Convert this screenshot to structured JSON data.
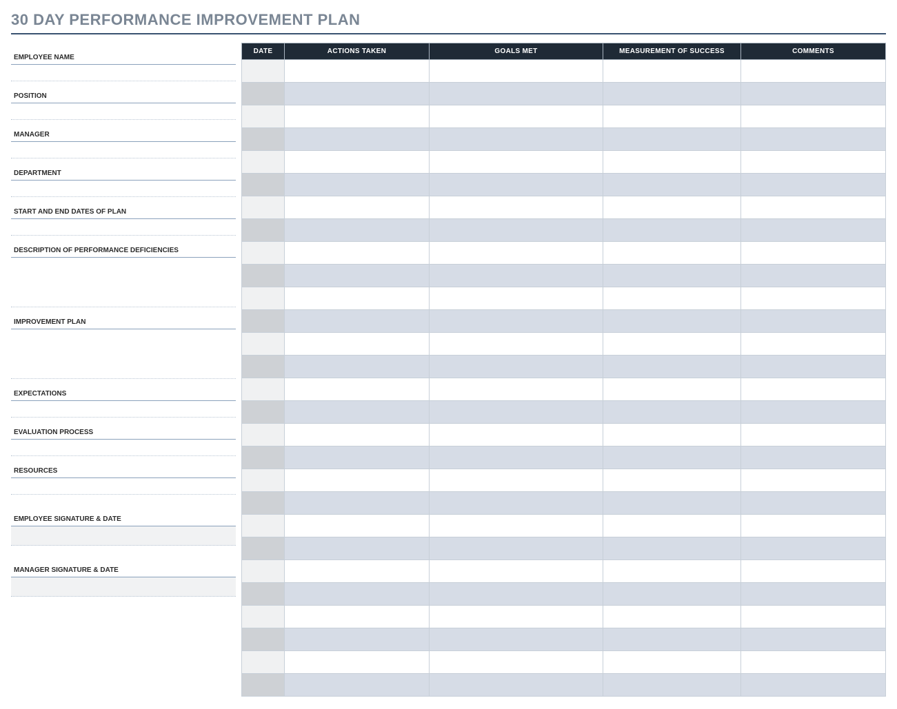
{
  "title": "30 DAY PERFORMANCE IMPROVEMENT PLAN",
  "left_fields": [
    {
      "label": "EMPLOYEE NAME",
      "type": "line"
    },
    {
      "label": "POSITION",
      "type": "line"
    },
    {
      "label": "MANAGER",
      "type": "line"
    },
    {
      "label": "DEPARTMENT",
      "type": "line"
    },
    {
      "label": "START AND END DATES OF PLAN",
      "type": "line"
    },
    {
      "label": "DESCRIPTION OF PERFORMANCE DEFICIENCIES",
      "type": "textarea"
    },
    {
      "label": "IMPROVEMENT PLAN",
      "type": "textarea"
    },
    {
      "label": "EXPECTATIONS",
      "type": "line"
    },
    {
      "label": "EVALUATION PROCESS",
      "type": "line"
    },
    {
      "label": "RESOURCES",
      "type": "line"
    }
  ],
  "signatures": [
    {
      "label": "EMPLOYEE SIGNATURE & DATE"
    },
    {
      "label": "MANAGER SIGNATURE & DATE"
    }
  ],
  "table": {
    "headers": [
      "DATE",
      "ACTIONS TAKEN",
      "GOALS MET",
      "MEASUREMENT OF SUCCESS",
      "COMMENTS"
    ],
    "row_count": 28
  }
}
